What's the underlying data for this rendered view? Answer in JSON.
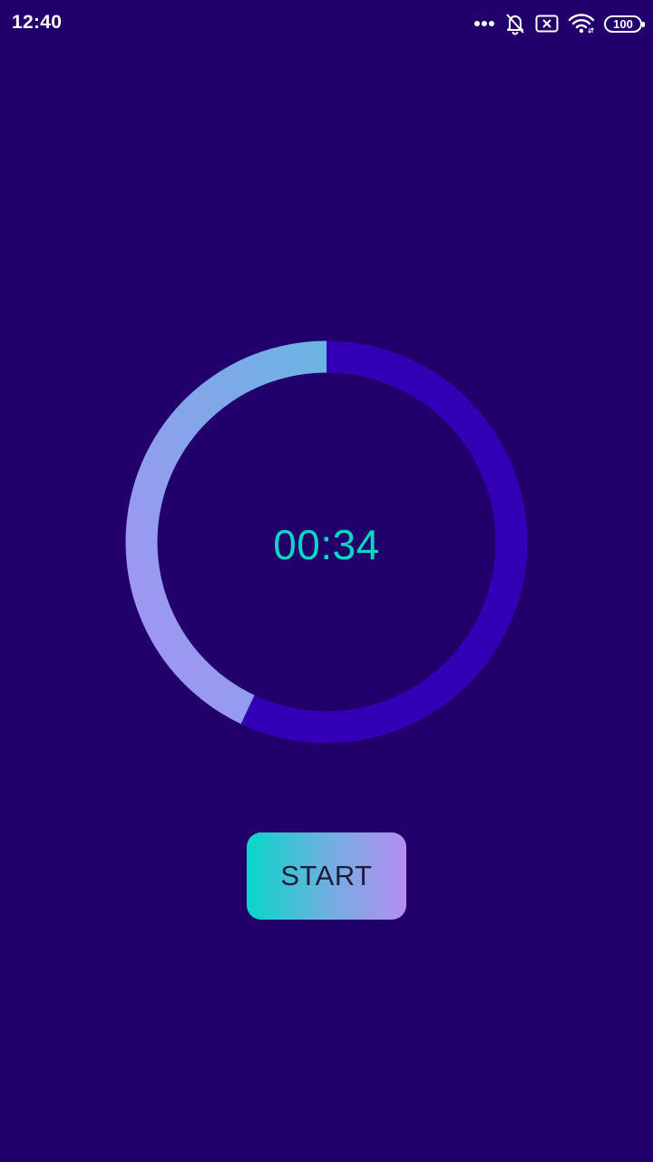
{
  "status_bar": {
    "time": "12:40",
    "battery": "100",
    "icons": [
      "more-dots-icon",
      "bell-off-icon",
      "sim-x-icon",
      "wifi-icon",
      "battery-icon"
    ]
  },
  "timer": {
    "display": "00:34",
    "progress_fraction": 0.43,
    "colors": {
      "background": "#22006b",
      "track": "#3300b5",
      "progress_start": "#a692f4",
      "progress_end": "#6ab4e2",
      "text": "#10d4c8"
    }
  },
  "controls": {
    "start_label": "START"
  }
}
